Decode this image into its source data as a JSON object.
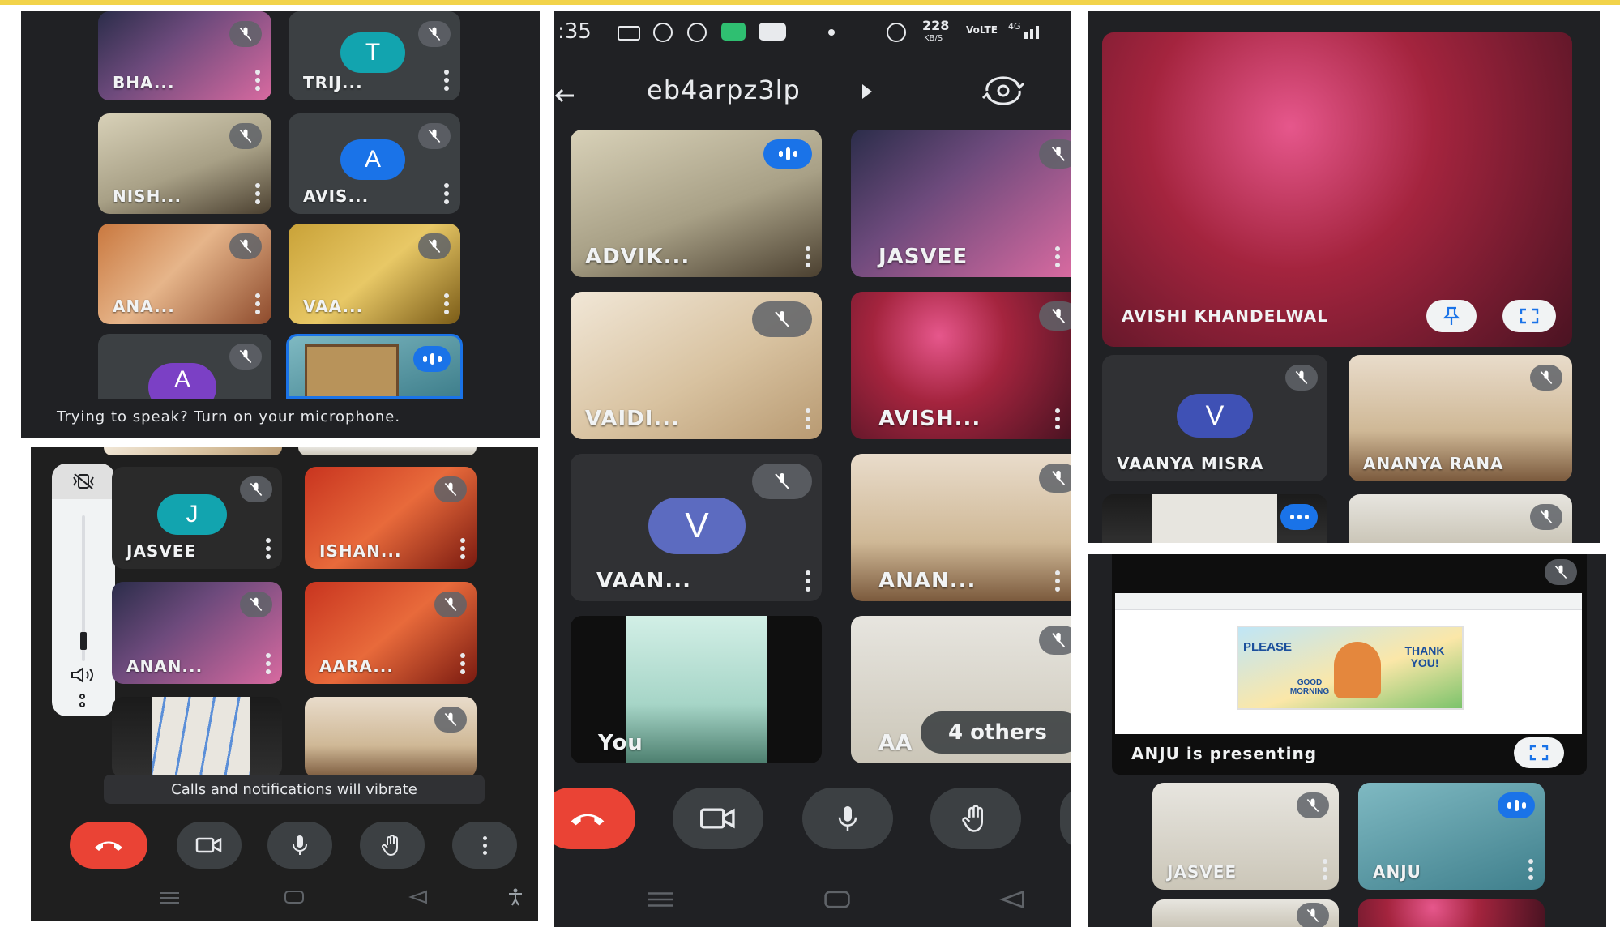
{
  "panel_left_top": {
    "tiles": [
      {
        "name": "BHA..."
      },
      {
        "name": "TRIJ...",
        "avatar_letter": "T",
        "avatar_color": "#12a4af"
      },
      {
        "name": "NISH..."
      },
      {
        "name": "AVIS...",
        "avatar_letter": "A",
        "avatar_color": "#1a73e8"
      },
      {
        "name": "ANA..."
      },
      {
        "name": "VAA..."
      },
      {
        "name": "",
        "avatar_letter": "A",
        "avatar_color": "#7b40c5"
      },
      {
        "name": ""
      }
    ],
    "hint": "Trying to speak? Turn on your microphone."
  },
  "panel_left_bottom": {
    "tiles": [
      {
        "name": "JASVEE",
        "avatar_letter": "J",
        "avatar_color": "#12a4af"
      },
      {
        "name": "ISHAN..."
      },
      {
        "name": "ANAN..."
      },
      {
        "name": "AARA..."
      },
      {
        "name": ""
      },
      {
        "name": ""
      }
    ],
    "toast": "Calls and notifications will vibrate"
  },
  "panel_center": {
    "status_bar": {
      "time": ":35",
      "network_speed": "228",
      "network_unit": "KB/S",
      "network_type": "VoLTE",
      "signal": "4G"
    },
    "meeting_code": "eb4arpz3lp",
    "tiles": [
      {
        "name": "ADVIK..."
      },
      {
        "name": "JASVEE"
      },
      {
        "name": "VAIDI..."
      },
      {
        "name": "AVISH..."
      },
      {
        "name": "VAAN...",
        "avatar_letter": "V",
        "avatar_color": "#5c6bc0"
      },
      {
        "name": "ANAN..."
      },
      {
        "name": "You"
      },
      {
        "name": "AA",
        "others_label": "4 others"
      }
    ]
  },
  "panel_right_top": {
    "featured_name": "AVISHI KHANDELWAL",
    "tiles": [
      {
        "name": "VAANYA MISRA",
        "avatar_letter": "V",
        "avatar_color": "#3f51b5"
      },
      {
        "name": "ANANYA RANA"
      }
    ]
  },
  "panel_right_bottom": {
    "presenting_label": "ANJU is presenting",
    "slide_words": [
      "PLEASE",
      "THANK YOU!",
      "GOOD MORNING"
    ],
    "tiles": [
      {
        "name": "JASVEE"
      },
      {
        "name": "ANJU"
      }
    ]
  },
  "colors": {
    "panel_bg": "#202124",
    "tile_bg": "#3c4043",
    "end_call": "#ea4335",
    "speaking": "#1a73e8",
    "frame_accent": "#f2d34a"
  }
}
